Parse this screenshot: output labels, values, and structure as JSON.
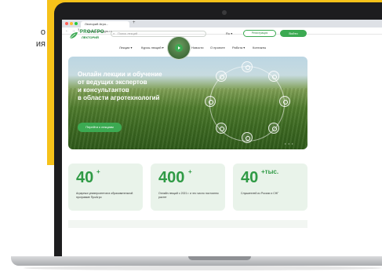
{
  "left_text": [
    "о",
    "ия"
  ],
  "browser": {
    "tab_title": "Лекторий Агро...",
    "new_tab": "+",
    "url": "lektoriy.proagro.ru",
    "nav_back": "←",
    "nav_forward": "→",
    "nav_reload": "↻"
  },
  "header": {
    "logo_top": "PROАГРО",
    "logo_bottom": "ЛЕКТОРИЙ",
    "search_placeholder": "Поиск лекций",
    "lang": "Ru ▾",
    "register_label": "Регистрация",
    "login_label": "Войти"
  },
  "menu": [
    {
      "label": "Лекции ▾"
    },
    {
      "label": "Курсы лекций ▾"
    },
    {
      "label": "Спикеры"
    },
    {
      "label": "Новости"
    },
    {
      "label": "О проекте"
    },
    {
      "label": "Работа ▾"
    },
    {
      "label": "Контакты"
    }
  ],
  "hero": {
    "title_lines": [
      "Онлайн лекции и обучение",
      "от ведущих экспертов",
      "и консультантов",
      "в области агротехнологий"
    ],
    "cta": "Перейти к лекциям",
    "dots": "• • •"
  },
  "stats": [
    {
      "number": "40",
      "sup": "+",
      "text": "Аграрных университетов в образовательной программе ПроАгро"
    },
    {
      "number": "400",
      "sup": "+",
      "text": "Онлайн лекций с 2021 г. и это число постоянно растет"
    },
    {
      "number": "40",
      "sup": "+тыс.",
      "text": "Слушателей из России и СНГ"
    }
  ],
  "colors": {
    "accent": "#3caa52",
    "yellow": "#f6c21a",
    "card_bg": "#e9f3ea"
  }
}
